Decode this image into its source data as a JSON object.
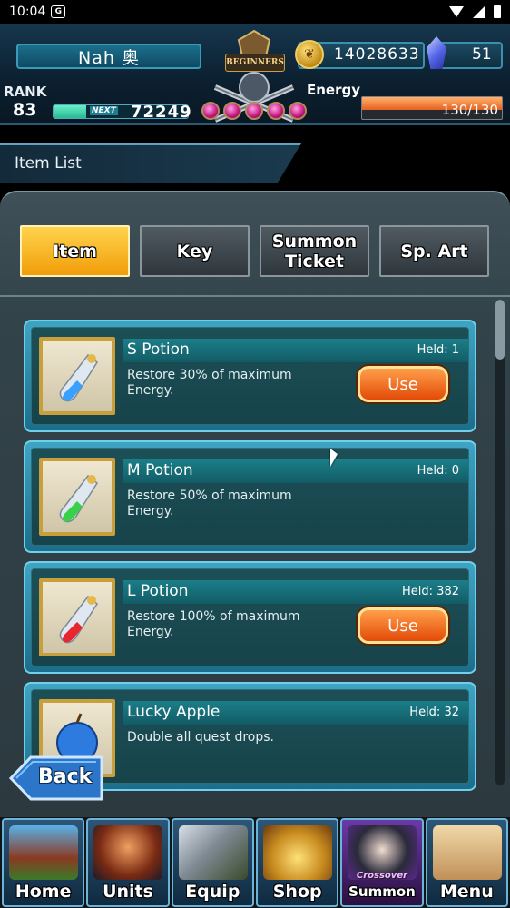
{
  "status_bar": {
    "time": "10:04",
    "app_badge": "G"
  },
  "header": {
    "player_name": "Nah 奥",
    "rank_label": "RANK",
    "rank": "83",
    "exp_next_label": "NEXT",
    "exp_next": "72249",
    "emblem_text": "BEGINNERS",
    "gold": "14028633",
    "gems": "51",
    "energy_label": "Energy",
    "energy": "130/130",
    "energy_fraction": 1.0
  },
  "page_title": "Item List",
  "tabs": [
    {
      "label": "Item",
      "active": true
    },
    {
      "label": "Key",
      "active": false
    },
    {
      "label": "Summon Ticket",
      "active": false
    },
    {
      "label": "Sp. Art",
      "active": false
    }
  ],
  "items": [
    {
      "name": "S Potion",
      "held": "Held: 1",
      "desc": "Restore 30% of maximum Energy.",
      "use_label": "Use",
      "potion_color": "#3aa0ff"
    },
    {
      "name": "M Potion",
      "held": "Held: 0",
      "desc": "Restore 50% of maximum Energy.",
      "use_label": "",
      "potion_color": "#39d14a"
    },
    {
      "name": "L Potion",
      "held": "Held: 382",
      "desc": "Restore 100% of maximum Energy.",
      "use_label": "Use",
      "potion_color": "#e8262f"
    },
    {
      "name": "Lucky Apple",
      "held": "Held: 32",
      "desc": "Double all quest drops.",
      "use_label": "",
      "potion_color": "#2e7be0"
    }
  ],
  "back_label": "Back",
  "bottom_nav": [
    {
      "label": "Home",
      "sub": ""
    },
    {
      "label": "Units",
      "sub": ""
    },
    {
      "label": "Equip",
      "sub": ""
    },
    {
      "label": "Shop",
      "sub": ""
    },
    {
      "label": "Summon",
      "sub": "Crossover"
    },
    {
      "label": "Menu",
      "sub": ""
    }
  ]
}
